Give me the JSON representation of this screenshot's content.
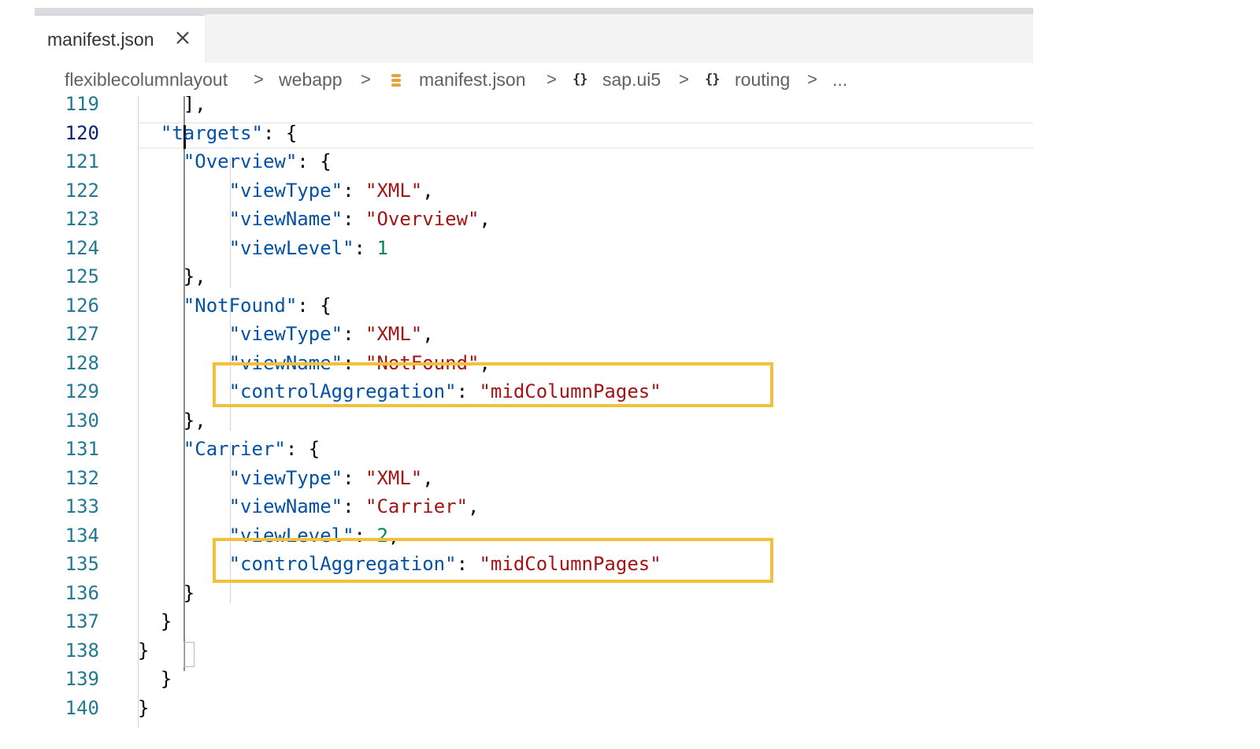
{
  "tab": {
    "label": "manifest.json"
  },
  "breadcrumb": [
    {
      "label": "flexiblecolumnlayout",
      "icon": ""
    },
    {
      "label": "webapp",
      "icon": ""
    },
    {
      "label": "manifest.json",
      "icon": "json-file-icon"
    },
    {
      "label": "sap.ui5",
      "icon": "braces-icon"
    },
    {
      "label": "routing",
      "icon": "braces-icon"
    },
    {
      "label": "...",
      "icon": ""
    }
  ],
  "code": {
    "lines": [
      {
        "num": "119",
        "text": "    ],"
      },
      {
        "num": "120",
        "text": "  \"targets\": {"
      },
      {
        "num": "121",
        "text": "    \"Overview\": {"
      },
      {
        "num": "122",
        "text": "        \"viewType\": \"XML\","
      },
      {
        "num": "123",
        "text": "        \"viewName\": \"Overview\","
      },
      {
        "num": "124",
        "text": "        \"viewLevel\": 1"
      },
      {
        "num": "125",
        "text": "    },"
      },
      {
        "num": "126",
        "text": "    \"NotFound\": {"
      },
      {
        "num": "127",
        "text": "        \"viewType\": \"XML\","
      },
      {
        "num": "128",
        "text": "        \"viewName\": \"NotFound\","
      },
      {
        "num": "129",
        "text": "        \"controlAggregation\": \"midColumnPages\""
      },
      {
        "num": "130",
        "text": "    },"
      },
      {
        "num": "131",
        "text": "    \"Carrier\": {"
      },
      {
        "num": "132",
        "text": "        \"viewType\": \"XML\","
      },
      {
        "num": "133",
        "text": "        \"viewName\": \"Carrier\","
      },
      {
        "num": "134",
        "text": "        \"viewLevel\": 2,"
      },
      {
        "num": "135",
        "text": "        \"controlAggregation\": \"midColumnPages\""
      },
      {
        "num": "136",
        "text": "    }"
      },
      {
        "num": "137",
        "text": "  }"
      },
      {
        "num": "138",
        "text": "}"
      },
      {
        "num": "139",
        "text": "  }"
      },
      {
        "num": "140",
        "text": "}"
      }
    ],
    "active_line": "120",
    "highlighted_lines": [
      "129",
      "135"
    ]
  },
  "colors": {
    "key": "#0451a5",
    "string": "#a31515",
    "number": "#098658",
    "line_number": "#237893",
    "highlight_box": "#f2c03a"
  }
}
